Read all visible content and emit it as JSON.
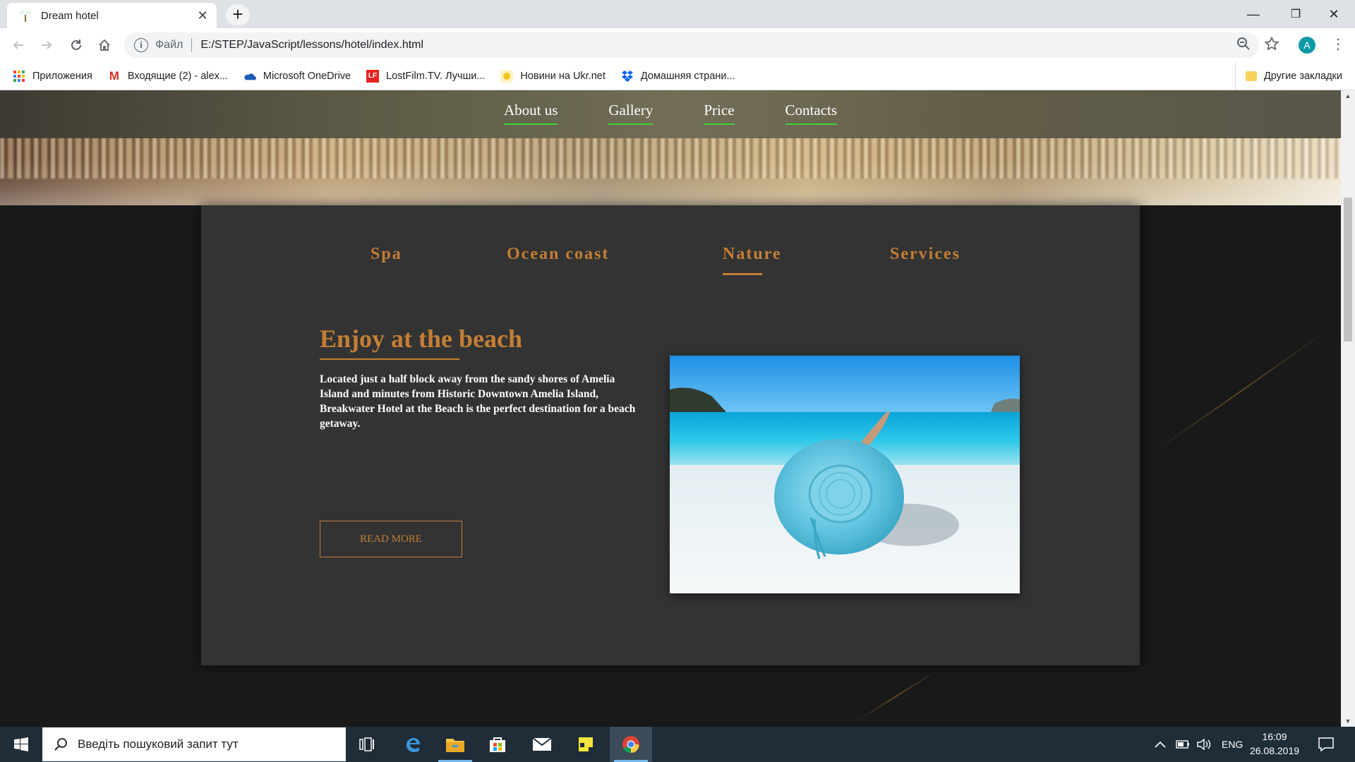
{
  "browser": {
    "tab_title": "Dream hotel",
    "tab_close": "✕",
    "new_tab": "+",
    "window_controls": {
      "minimize": "—",
      "maximize": "❐",
      "close": "✕"
    },
    "scheme_label": "Файл",
    "url": "E:/STEP/JavaScript/lessons/hotel/index.html",
    "profile_initial": "A",
    "bookmarks": [
      {
        "label": "Приложения",
        "icon": "apps-grid-icon"
      },
      {
        "label": "Входящие (2) - alex...",
        "icon": "gmail-icon"
      },
      {
        "label": "Microsoft OneDrive",
        "icon": "onedrive-icon"
      },
      {
        "label": "LostFilm.TV. Лучши...",
        "icon": "lostfilm-icon"
      },
      {
        "label": "Новини на Ukr.net",
        "icon": "ukrnet-icon"
      },
      {
        "label": "Домашняя страни...",
        "icon": "dropbox-icon"
      }
    ],
    "other_bookmarks": "Другие закладки"
  },
  "page": {
    "nav": [
      "About us",
      "Gallery",
      "Price",
      "Contacts"
    ],
    "tabs": [
      "Spa",
      "Ocean coast",
      "Nature",
      "Services"
    ],
    "active_tab": "Nature",
    "heading": "Enjoy at the beach",
    "body": "Located just a half block away from the sandy shores of Amelia Island and minutes from Historic Downtown Amelia Island, Breakwater Hotel at the Beach is the perfect destination for a beach getaway.",
    "button": "READ MORE"
  },
  "taskbar": {
    "search_placeholder": "Введіть пошуковий запит тут",
    "language": "ENG",
    "time": "16:09",
    "date": "26.08.2019"
  },
  "colors": {
    "accent": "#c47f35",
    "nav_underline": "#3cd33c",
    "panel": "#333333"
  }
}
